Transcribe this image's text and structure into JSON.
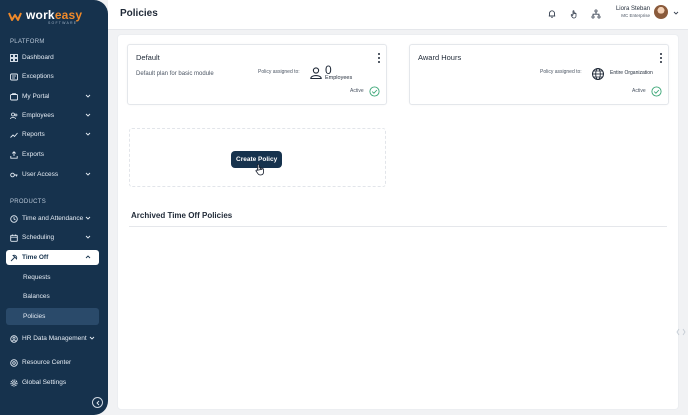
{
  "app": {
    "logo_main": "work",
    "logo_accent": "easy",
    "logo_sub": "SOFTWARE"
  },
  "sidebar": {
    "platform_label": "PLATFORM",
    "platform_items": [
      {
        "label": "Dashboard",
        "icon": "dashboard-icon"
      },
      {
        "label": "Exceptions",
        "icon": "exceptions-icon"
      },
      {
        "label": "My Portal",
        "icon": "portal-icon",
        "expandable": true
      },
      {
        "label": "Employees",
        "icon": "employees-icon",
        "expandable": true
      },
      {
        "label": "Reports",
        "icon": "reports-icon",
        "expandable": true
      },
      {
        "label": "Exports",
        "icon": "exports-icon"
      },
      {
        "label": "User Access",
        "icon": "user-access-icon",
        "expandable": true
      }
    ],
    "products_label": "PRODUCTS",
    "product_items": [
      {
        "label": "Time and Attendance",
        "icon": "clock-icon",
        "expandable": true
      },
      {
        "label": "Scheduling",
        "icon": "calendar-icon",
        "expandable": true
      },
      {
        "label": "Time Off",
        "icon": "time-off-icon",
        "expandable": true,
        "active": true
      }
    ],
    "time_off_sub": [
      "Requests",
      "Balances",
      "Policies"
    ],
    "selected_sub": "Policies",
    "hr_item": {
      "label": "HR Data Management",
      "icon": "hr-icon"
    },
    "bottom_items": [
      {
        "label": "Resource Center",
        "icon": "resource-icon"
      },
      {
        "label": "Global Settings",
        "icon": "settings-icon"
      }
    ]
  },
  "header": {
    "title": "Policies",
    "user_name": "Liora Steban",
    "user_org": "MC Enterprise"
  },
  "policies": [
    {
      "title": "Default",
      "description": "Default plan for basic module",
      "assigned_label": "Policy assigned to:",
      "count": "0",
      "count_unit": "Employees",
      "status": "Active"
    },
    {
      "title": "Award Hours",
      "description": "",
      "assigned_label": "Policy assigned to:",
      "scope": "Entire Organization",
      "status": "Active"
    }
  ],
  "create_button": "Create Policy",
  "archived_title": "Archived Time Off Policies",
  "colors": {
    "sidebar": "#16324d",
    "accent": "#f08a2a",
    "active_check": "#3aa676"
  }
}
